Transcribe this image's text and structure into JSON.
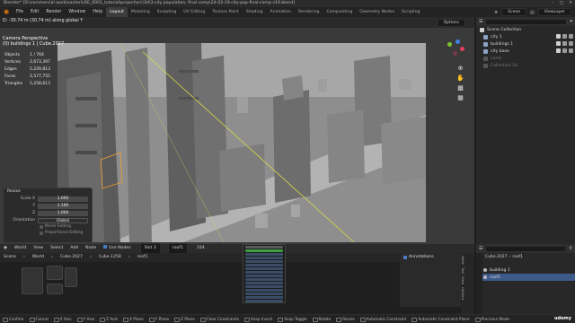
{
  "app": {
    "title": "Blender* [D:\\commercial work\\earlier\\LRE_0001_tutorial\\project\\src\\3d\\3-city population, final comp\\24-02-19-city-pop-final-comp-v19.blend]"
  },
  "menu": [
    "File",
    "Edit",
    "Render",
    "Window",
    "Help"
  ],
  "workspaces": [
    "Layout",
    "Modeling",
    "Sculpting",
    "UV Editing",
    "Texture Paint",
    "Shading",
    "Animation",
    "Rendering",
    "Compositing",
    "Geometry Nodes",
    "Scripting"
  ],
  "workspace_active": "Layout",
  "scene_name": "Scene",
  "view_layer": "ViewLayer",
  "viewport": {
    "status_message": "D: -30.74 m (30.74 m) along global Y",
    "options_label": "Options",
    "camera_label": "Camera Perspective",
    "camera_sub": "(0) buildings 1 | Cube.2027",
    "stats": [
      {
        "label": "Objects",
        "value": "1 / 764"
      },
      {
        "label": "Vertices",
        "value": "2,673,397"
      },
      {
        "label": "Edges",
        "value": "5,229,813"
      },
      {
        "label": "Faces",
        "value": "2,577,755"
      },
      {
        "label": "Triangles",
        "value": "5,258,613"
      }
    ]
  },
  "redo_panel": {
    "title": "Resize",
    "fields": [
      {
        "label": "Scale X",
        "value": "1.000"
      },
      {
        "label": "Y",
        "value": "1.190"
      },
      {
        "label": "Z",
        "value": "1.000"
      }
    ],
    "orientation_label": "Orientation",
    "orientation_value": "Global",
    "mirror_label": "Mirror Editing",
    "proportional_label": "Proportional Editing"
  },
  "outliner": {
    "root": "Scene Collection",
    "items": [
      {
        "label": "city 1",
        "dim": false
      },
      {
        "label": "buildings 1",
        "dim": false
      },
      {
        "label": "city base",
        "dim": false
      },
      {
        "label": "cams",
        "dim": true
      },
      {
        "label": "Collection 10",
        "dim": true
      }
    ]
  },
  "bottom_editor": {
    "header1": [
      "World",
      "View",
      "Select",
      "Add",
      "Node"
    ],
    "use_nodes_label": "Use Nodes",
    "slot_label": "Slot 3",
    "material_name": "roof1",
    "users_count": "104",
    "header2": [
      "Scene",
      "World",
      "Cube.2027",
      "Cube.1258",
      "roof1"
    ],
    "annotations_label": "Annotations",
    "side_tabs": [
      "Node",
      "Tool",
      "View",
      "Options"
    ]
  },
  "properties": {
    "crumb_object": "Cube.2027",
    "crumb_material": "roof1",
    "items": [
      {
        "label": "building 1",
        "selected": false
      },
      {
        "label": "roof1",
        "selected": true
      }
    ]
  },
  "statusbar": [
    "Confirm",
    "Cancel",
    "X Axis",
    "Y Axis",
    "Z Axis",
    "X Plane",
    "Y Plane",
    "Z Plane",
    "Clear Constraints",
    "Snap Invert",
    "Snap Toggle",
    "Rotate",
    "Resize",
    "Automatic Constraint",
    "Automatic Constraint Plane",
    "Precision Mode"
  ],
  "watermark": "udemy",
  "colors": {
    "accent_orange": "#e87d0d",
    "selection_blue": "#3c5a8a",
    "gizmo_x": "#e0405a",
    "gizmo_y": "#7ec42e",
    "gizmo_z": "#3f83e0"
  }
}
